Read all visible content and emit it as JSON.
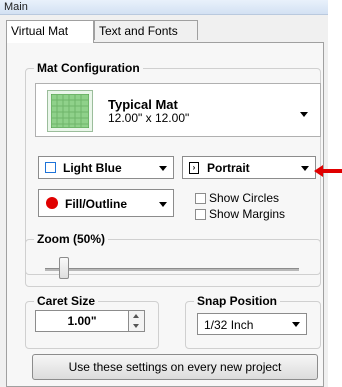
{
  "panel": {
    "title": "Main"
  },
  "tabs": [
    {
      "label": "Virtual Mat",
      "active": true
    },
    {
      "label": "Text and Fonts",
      "active": false
    }
  ],
  "mat_configuration": {
    "legend": "Mat Configuration",
    "mat": {
      "name": "Typical Mat",
      "size": "12.00\" x 12.00\"",
      "icon": "green-grid-mat-icon",
      "color": "#8fd18a"
    },
    "color_dropdown": {
      "value": "Light Blue",
      "icon": "light-blue-square-icon",
      "color": "#1e73d8"
    },
    "orientation_dropdown": {
      "value": "Portrait",
      "icon": "portrait-orientation-icon"
    },
    "display_dropdown": {
      "value": "Fill/Outline",
      "icon": "red-circle-icon",
      "color": "#e00000"
    },
    "show_circles": {
      "label": "Show Circles",
      "checked": false
    },
    "show_margins": {
      "label": "Show Margins",
      "checked": false
    }
  },
  "annotation": {
    "icon": "red-arrow-icon",
    "color": "#e00000"
  },
  "zoom": {
    "legend": "Zoom (50%)",
    "value_percent": 50
  },
  "caret_size": {
    "legend": "Caret Size",
    "value": "1.00\""
  },
  "snap_position": {
    "legend": "Snap Position",
    "value": "1/32 Inch"
  },
  "apply_button": {
    "label": "Use these settings on every new project"
  }
}
